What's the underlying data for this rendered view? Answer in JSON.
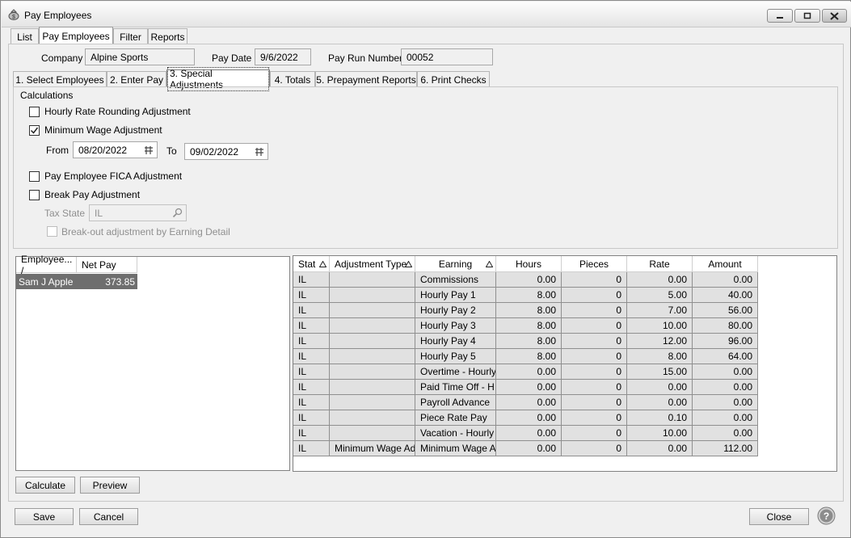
{
  "window": {
    "title": "Pay Employees"
  },
  "top_tabs": [
    "List",
    "Pay Employees",
    "Filter",
    "Reports"
  ],
  "header": {
    "company_label": "Company",
    "company_value": "Alpine Sports",
    "paydate_label": "Pay Date",
    "paydate_value": "9/6/2022",
    "payrun_label": "Pay Run Number",
    "payrun_value": "00052"
  },
  "sub_tabs": [
    "1. Select Employees",
    "2. Enter Pay",
    "3. Special Adjustments",
    "4. Totals",
    "5. Prepayment Reports",
    "6. Print Checks"
  ],
  "calculations": {
    "group_label": "Calculations",
    "hourly_rounding": {
      "label": "Hourly Rate Rounding Adjustment",
      "checked": false
    },
    "min_wage": {
      "label": "Minimum Wage Adjustment",
      "checked": true
    },
    "from_label": "From",
    "from_value": "08/20/2022",
    "to_label": "To",
    "to_value": "09/02/2022",
    "fica": {
      "label": "Pay Employee FICA Adjustment",
      "checked": false
    },
    "break_pay": {
      "label": "Break Pay Adjustment",
      "checked": false
    },
    "tax_state_label": "Tax State",
    "tax_state_value": "IL",
    "breakout": {
      "label": "Break-out adjustment by Earning Detail",
      "checked": false
    }
  },
  "employee_grid": {
    "headers": [
      "Employee... /",
      "Net Pay"
    ],
    "rows": [
      [
        "Sam J Apple",
        "373.85"
      ]
    ]
  },
  "detail_grid": {
    "headers": [
      "Stat",
      "Adjustment Type",
      "Earning",
      "Hours",
      "Pieces",
      "Rate",
      "Amount"
    ],
    "rows": [
      [
        "IL",
        "",
        "Commissions",
        "0.00",
        "0",
        "0.00",
        "0.00"
      ],
      [
        "IL",
        "",
        "Hourly Pay 1",
        "8.00",
        "0",
        "5.00",
        "40.00"
      ],
      [
        "IL",
        "",
        "Hourly Pay 2",
        "8.00",
        "0",
        "7.00",
        "56.00"
      ],
      [
        "IL",
        "",
        "Hourly Pay 3",
        "8.00",
        "0",
        "10.00",
        "80.00"
      ],
      [
        "IL",
        "",
        "Hourly Pay 4",
        "8.00",
        "0",
        "12.00",
        "96.00"
      ],
      [
        "IL",
        "",
        "Hourly Pay 5",
        "8.00",
        "0",
        "8.00",
        "64.00"
      ],
      [
        "IL",
        "",
        "Overtime - Hourly",
        "0.00",
        "0",
        "15.00",
        "0.00"
      ],
      [
        "IL",
        "",
        "Paid Time Off - H",
        "0.00",
        "0",
        "0.00",
        "0.00"
      ],
      [
        "IL",
        "",
        "Payroll Advance",
        "0.00",
        "0",
        "0.00",
        "0.00"
      ],
      [
        "IL",
        "",
        "Piece Rate Pay",
        "0.00",
        "0",
        "0.10",
        "0.00"
      ],
      [
        "IL",
        "",
        "Vacation - Hourly",
        "0.00",
        "0",
        "10.00",
        "0.00"
      ],
      [
        "IL",
        "Minimum Wage Ad",
        "Minimum Wage A",
        "0.00",
        "0",
        "0.00",
        "112.00"
      ]
    ]
  },
  "buttons": {
    "calculate": "Calculate",
    "preview": "Preview",
    "save": "Save",
    "cancel": "Cancel",
    "close": "Close"
  },
  "icons": {
    "app": "money-bag-icon",
    "calendar": "calendar-icon",
    "search": "search-icon",
    "help": "help-icon",
    "sort": "sort-triangle-icon"
  }
}
